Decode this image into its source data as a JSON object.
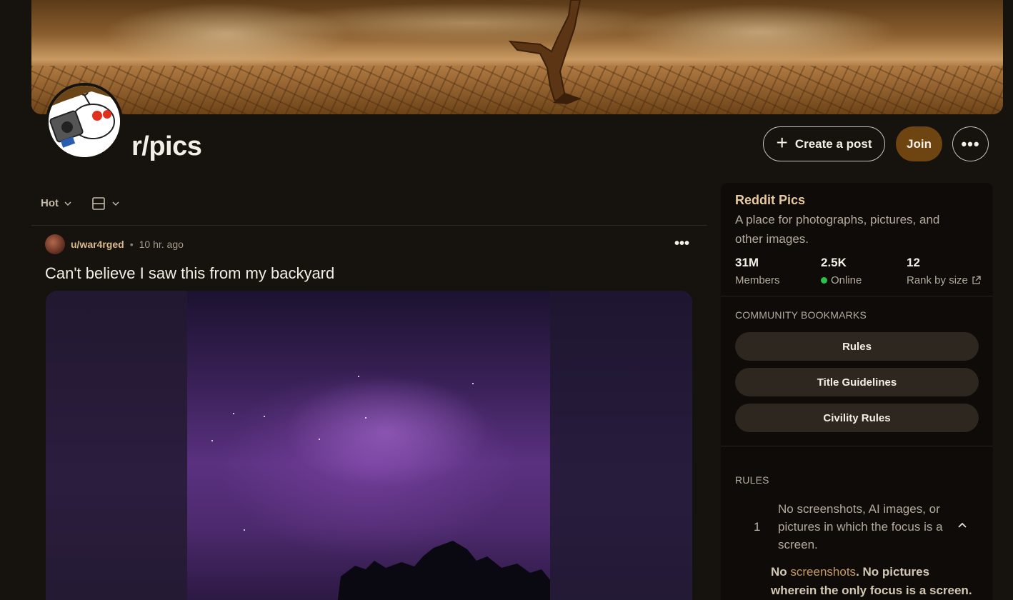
{
  "community": {
    "name": "r/pics"
  },
  "header": {
    "create_post_label": "Create a post",
    "join_label": "Join",
    "more_label": "•••"
  },
  "feed": {
    "sort_label": "Hot"
  },
  "post": {
    "author": "u/war4rged",
    "separator": "•",
    "time": "10 hr. ago",
    "menu_label": "•••",
    "title": "Can't believe I saw this from my backyard"
  },
  "sidebar": {
    "title": "Reddit Pics",
    "description": "A place for photographs, pictures, and other images.",
    "stats": [
      {
        "value": "31M",
        "label": "Members"
      },
      {
        "value": "2.5K",
        "label": "Online"
      },
      {
        "value": "12",
        "label": "Rank by size"
      }
    ],
    "bookmarks_heading": "COMMUNITY BOOKMARKS",
    "bookmarks": [
      "Rules",
      "Title Guidelines",
      "Civility Rules"
    ],
    "rules_heading": "RULES",
    "rules": [
      {
        "number": "1",
        "text": "No screenshots, AI images, or pictures in which the focus is a screen.",
        "detail_pre": "No ",
        "detail_link": "screenshots",
        "detail_post": ". No pictures wherein the only focus is a screen."
      }
    ]
  },
  "colors": {
    "background": "#16120d",
    "join_button": "#6e4411",
    "sidebar_title": "#e7c9a0",
    "online_dot": "#2bc24a",
    "author": "#d9b98f"
  },
  "icons": {
    "create_post": "plus-icon",
    "more": "ellipsis-icon",
    "sort": "chevron-down-icon",
    "view": "card-view-icon",
    "external": "external-link-icon",
    "rule_toggle": "chevron-up-icon"
  }
}
